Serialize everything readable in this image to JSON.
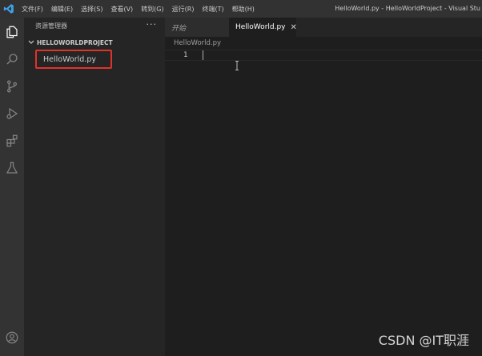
{
  "titlebar": {
    "menu": [
      "文件(F)",
      "编辑(E)",
      "选择(S)",
      "查看(V)",
      "转到(G)",
      "运行(R)",
      "终端(T)",
      "帮助(H)"
    ],
    "window_title": "HelloWorld.py - HelloWorldProject - Visual Stu"
  },
  "activitybar": {
    "icons": [
      "explorer-icon",
      "search-icon",
      "source-control-icon",
      "run-debug-icon",
      "extensions-icon",
      "testing-icon",
      "account-icon"
    ]
  },
  "sidebar": {
    "header": "资源管理器",
    "more": "···",
    "project": "HELLOWORLDPROJECT",
    "files": [
      "HelloWorld.py"
    ]
  },
  "tabs": [
    {
      "label": "开始"
    },
    {
      "label": "HelloWorld.py",
      "close": "✕"
    }
  ],
  "editor": {
    "breadcrumb": "HelloWorld.py",
    "line_number": "1"
  },
  "watermark": "CSDN @IT职涯",
  "colors": {
    "highlight_border": "#e0332a",
    "activity_bar": "#333333",
    "sidebar": "#252526",
    "editor": "#1e1e1e"
  }
}
